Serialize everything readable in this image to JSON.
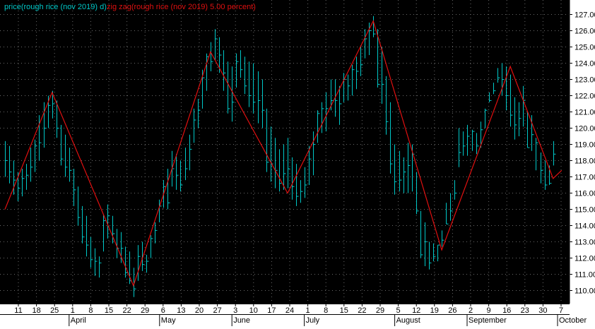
{
  "legend": {
    "price_label": "price(rough rice (nov 2019) d)",
    "zigzag_label": "zig zag(rough rice (nov 2019) 5.00 percent)"
  },
  "colors": {
    "background": "#000000",
    "price_bars": "#00c8c8",
    "zigzag_line": "#e01010",
    "grid_dots": "#6a6a6a",
    "axis_panel": "#ffffff"
  },
  "chart_data": {
    "type": "line",
    "title": "",
    "grid": true,
    "ylim": [
      109.3,
      127.4
    ],
    "y_ticks": [
      "110.00",
      "111.00",
      "112.00",
      "113.00",
      "114.00",
      "115.00",
      "116.00",
      "117.00",
      "118.00",
      "119.00",
      "120.00",
      "121.00",
      "122.00",
      "123.00",
      "124.00",
      "125.00",
      "126.00",
      "127.00"
    ],
    "x_tick_labels": [
      "11",
      "18",
      "25",
      "1",
      "8",
      "15",
      "22",
      "29",
      "6",
      "13",
      "20",
      "27",
      "3",
      "10",
      "17",
      "24",
      "1",
      "8",
      "15",
      "22",
      "29",
      "5",
      "12",
      "19",
      "26",
      "2",
      "9",
      "16",
      "23",
      "30",
      "7"
    ],
    "months": [
      "April",
      "May",
      "June",
      "July",
      "August",
      "September",
      "October"
    ],
    "series": [
      {
        "name": "price(rough rice (nov 2019) d)",
        "kind": "hlc_bars",
        "highs": [
          119.2,
          118.9,
          118.0,
          117.3,
          117.5,
          117.8,
          118.8,
          119.3,
          120.8,
          121.6,
          122.0,
          122.3,
          121.7,
          120.2,
          119.6,
          118.8,
          117.5,
          116.4,
          115.2,
          114.6,
          113.3,
          112.6,
          112.1,
          114.7,
          115.3,
          114.6,
          113.8,
          113.6,
          112.7,
          112.4,
          111.4,
          112.8,
          113.0,
          112.2,
          113.4,
          114.2,
          115.6,
          116.8,
          117.5,
          118.6,
          118.4,
          118.0,
          118.8,
          119.6,
          121.2,
          121.8,
          123.6,
          124.6,
          125.3,
          126.1,
          125.6,
          124.8,
          124.1,
          123.8,
          124.6,
          124.8,
          124.4,
          124.1,
          124.0,
          123.5,
          123.0,
          121.2,
          120.1,
          119.4,
          118.7,
          119.0,
          119.4,
          118.2,
          117.8,
          116.8,
          117.6,
          118.9,
          119.8,
          121.1,
          121.6,
          122.2,
          123.0,
          123.0,
          122.6,
          123.4,
          123.3,
          123.9,
          124.4,
          125.1,
          126.1,
          126.5,
          126.9,
          126.1,
          125.0,
          123.2,
          121.6,
          119.0,
          118.6,
          118.2,
          119.1,
          119.0,
          117.3,
          114.9,
          114.2,
          113.0,
          112.9,
          112.8,
          113.7,
          115.4,
          116.0,
          116.8,
          120.0,
          119.8,
          120.2,
          119.9,
          119.7,
          120.4,
          121.2,
          122.2,
          122.8,
          123.7,
          124.0,
          123.8,
          123.3,
          121.9,
          121.6,
          122.6,
          121.0,
          120.8,
          119.4,
          118.5,
          118.0,
          117.7,
          119.2
        ],
        "lows": [
          117.0,
          116.6,
          115.9,
          115.5,
          115.8,
          116.2,
          116.7,
          117.3,
          118.0,
          118.8,
          120.0,
          120.6,
          119.4,
          117.7,
          117.0,
          116.7,
          115.2,
          114.0,
          112.9,
          112.1,
          111.4,
          110.9,
          110.8,
          112.4,
          113.2,
          112.9,
          112.0,
          111.7,
          110.8,
          110.4,
          109.6,
          110.6,
          111.2,
          111.1,
          112.0,
          112.9,
          114.2,
          115.1,
          115.0,
          116.4,
          116.2,
          116.1,
          116.8,
          117.4,
          119.1,
          120.0,
          121.2,
          122.3,
          123.5,
          124.2,
          123.4,
          122.3,
          120.9,
          120.4,
          122.5,
          123.1,
          122.1,
          121.3,
          120.9,
          120.3,
          120.0,
          117.3,
          116.7,
          116.3,
          116.1,
          116.2,
          116.3,
          115.6,
          115.2,
          115.4,
          115.7,
          116.5,
          117.1,
          119.1,
          119.7,
          119.8,
          121.1,
          120.7,
          120.2,
          121.6,
          121.7,
          122.0,
          122.4,
          123.2,
          124.3,
          124.5,
          125.6,
          122.5,
          121.5,
          119.6,
          117.2,
          115.9,
          116.1,
          116.0,
          116.0,
          116.1,
          114.7,
          112.0,
          111.5,
          111.3,
          111.8,
          111.8,
          112.7,
          114.1,
          114.3,
          115.6,
          117.6,
          118.3,
          118.3,
          118.6,
          118.4,
          118.8,
          120.0,
          121.6,
          122.1,
          122.8,
          122.0,
          121.1,
          120.1,
          119.3,
          119.5,
          120.1,
          118.8,
          118.6,
          117.4,
          116.6,
          116.2,
          116.5,
          117.7
        ],
        "closes": [
          118.0,
          117.3,
          116.8,
          116.3,
          116.9,
          117.1,
          117.6,
          118.9,
          119.1,
          120.0,
          121.4,
          121.5,
          120.0,
          118.1,
          117.6,
          117.4,
          116.2,
          114.5,
          113.3,
          112.8,
          111.9,
          111.8,
          111.7,
          114.3,
          114.6,
          113.5,
          112.6,
          112.6,
          111.1,
          110.6,
          110.1,
          112.1,
          111.6,
          111.8,
          113.2,
          113.7,
          115.2,
          116.4,
          115.4,
          117.5,
          117.1,
          116.5,
          117.5,
          118.7,
          120.5,
          121.1,
          123.1,
          124.4,
          124.1,
          125.5,
          124.5,
          123.4,
          121.2,
          121.6,
          124.1,
          123.6,
          122.6,
          122.0,
          121.6,
          121.7,
          121.1,
          117.9,
          117.8,
          117.4,
          116.6,
          117.2,
          117.5,
          116.4,
          115.8,
          116.1,
          116.5,
          118.1,
          119.0,
          120.9,
          121.2,
          121.2,
          121.7,
          121.7,
          121.5,
          123.0,
          122.6,
          123.6,
          123.5,
          123.9,
          125.5,
          126.0,
          125.8,
          122.7,
          122.7,
          120.4,
          117.8,
          116.7,
          116.8,
          117.3,
          117.7,
          118.4,
          114.9,
          112.2,
          113.0,
          111.7,
          112.1,
          112.8,
          113.1,
          114.1,
          114.9,
          116.0,
          118.5,
          118.9,
          119.5,
          119.8,
          118.9,
          119.9,
          121.1,
          121.7,
          122.3,
          123.1,
          123.0,
          122.0,
          120.8,
          120.2,
          120.6,
          121.7,
          118.8,
          119.6,
          119.1,
          117.4,
          116.5,
          116.6,
          118.4
        ]
      },
      {
        "name": "zig zag(rough rice (nov 2019) 5.00 percent)",
        "kind": "line",
        "points": [
          [
            0,
            115.0
          ],
          [
            11,
            122.2
          ],
          [
            30,
            110.3
          ],
          [
            48,
            124.7
          ],
          [
            66,
            116.0
          ],
          [
            86,
            126.6
          ],
          [
            102,
            112.5
          ],
          [
            118,
            123.8
          ],
          [
            128,
            116.9
          ],
          [
            130,
            117.4
          ]
        ]
      }
    ]
  }
}
